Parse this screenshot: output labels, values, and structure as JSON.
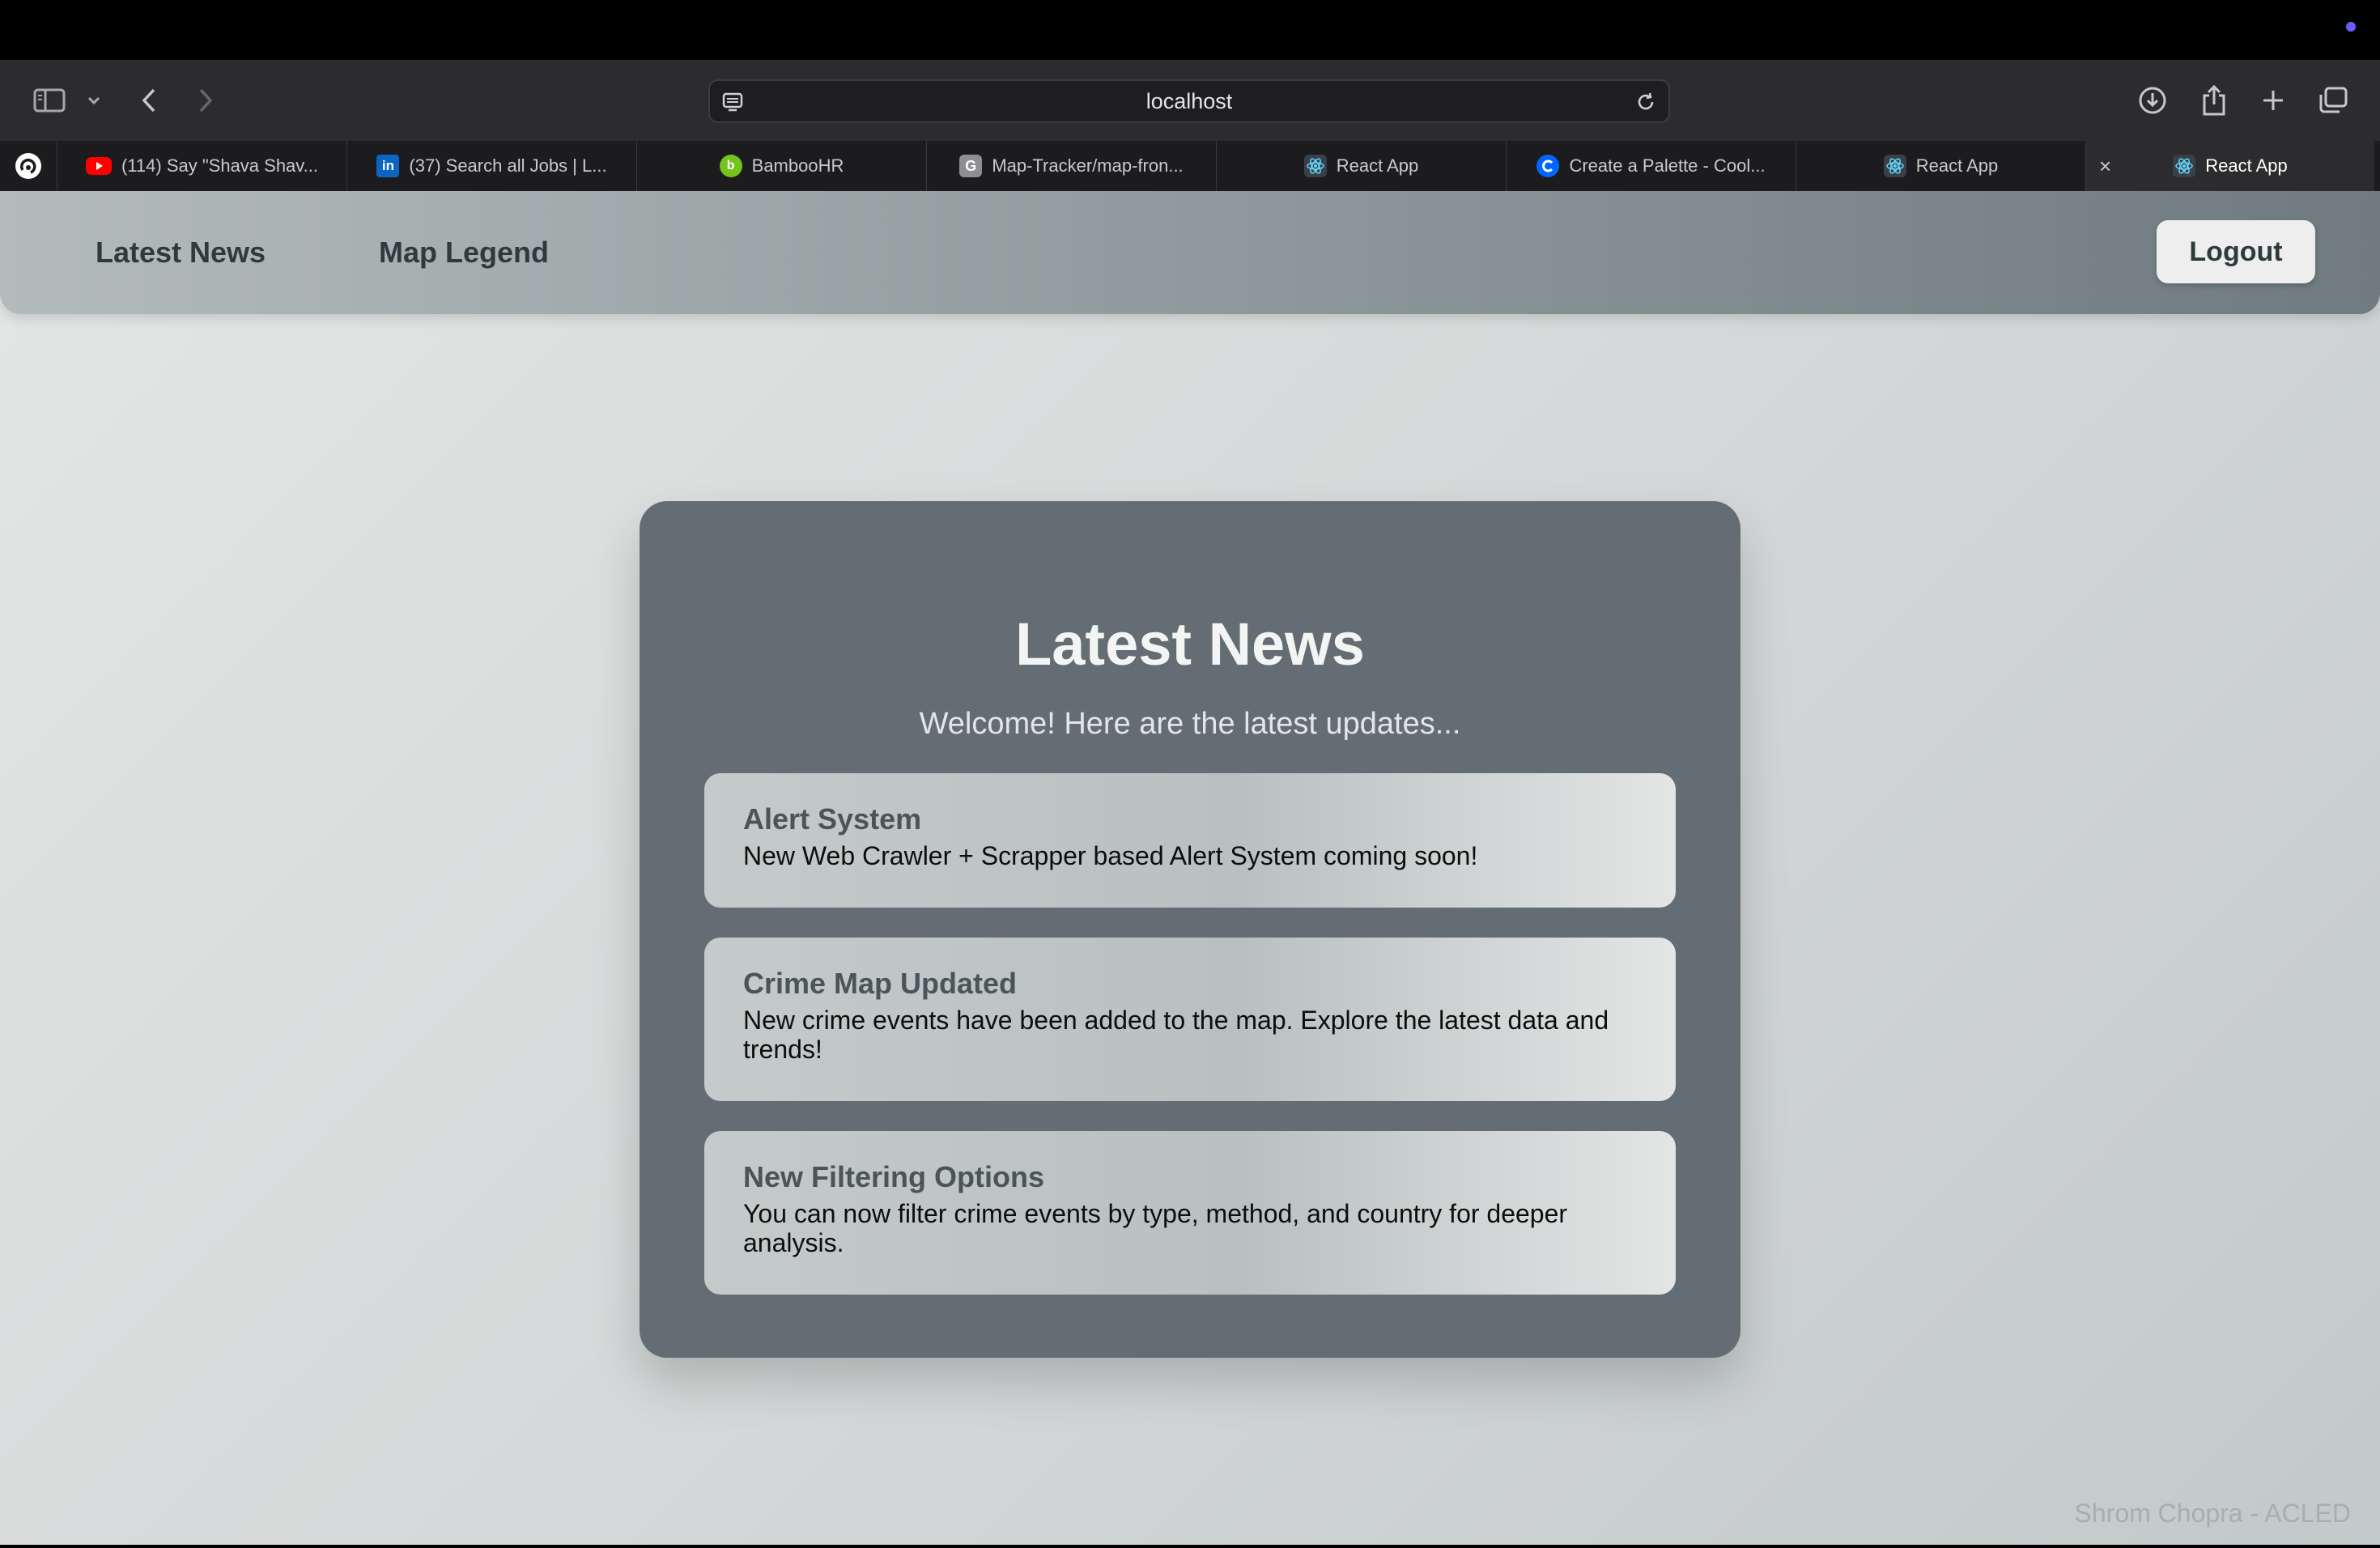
{
  "browser": {
    "address": "localhost",
    "tabs": [
      {
        "label": "(114) Say \"Shava Shav...",
        "icon": "youtube-icon",
        "color": "#ff0000"
      },
      {
        "label": "(37) Search all Jobs | L...",
        "icon": "linkedin-icon",
        "color": "#0a66c2"
      },
      {
        "label": "BambooHR",
        "icon": "bamboohr-icon",
        "color": "#73c41d"
      },
      {
        "label": "Map-Tracker/map-fron...",
        "icon": "github-icon",
        "color": "#8e8e93"
      },
      {
        "label": "React App",
        "icon": "react-icon",
        "color": "#61dafb"
      },
      {
        "label": "Create a Palette - Cool...",
        "icon": "coolors-icon",
        "color": "#0066ff"
      },
      {
        "label": "React App",
        "icon": "react-icon",
        "color": "#61dafb"
      },
      {
        "label": "React App",
        "icon": "react-icon",
        "color": "#61dafb",
        "active": true
      }
    ]
  },
  "navbar": {
    "links": [
      "Latest News",
      "Map Legend"
    ],
    "logout": "Logout"
  },
  "card": {
    "title": "Latest News",
    "subtitle": "Welcome! Here are the latest updates...",
    "items": [
      {
        "title": "Alert System",
        "body": "New Web Crawler + Scrapper based Alert System coming soon!"
      },
      {
        "title": "Crime Map Updated",
        "body": "New crime events have been added to the map. Explore the latest data and trends!"
      },
      {
        "title": "New Filtering Options",
        "body": "You can now filter crime events by type, method, and country for deeper analysis."
      }
    ]
  },
  "footer": "Shrom Chopra - ACLED",
  "colors": {
    "card_bg": "#636d73",
    "nav_text": "#2e3b3d",
    "logout_bg": "#eeeeee"
  }
}
